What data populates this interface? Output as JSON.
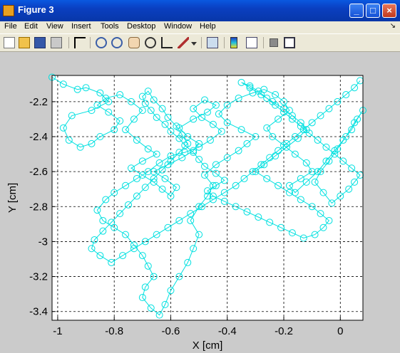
{
  "window": {
    "title": "Figure 3"
  },
  "menu": {
    "items": [
      "File",
      "Edit",
      "View",
      "Insert",
      "Tools",
      "Desktop",
      "Window",
      "Help"
    ],
    "overflow_glyph": "↘"
  },
  "toolbar": {
    "icons": [
      "new-figure-icon",
      "open-file-icon",
      "save-icon",
      "print-icon",
      "arrow-select-icon",
      "zoom-in-icon",
      "zoom-out-icon",
      "pan-hand-icon",
      "rotate-3d-icon",
      "data-cursor-icon",
      "brush-icon",
      "link-plot-icon",
      "colorbar-icon",
      "legend-icon",
      "hide-plot-tools-icon",
      "show-plot-tools-icon"
    ]
  },
  "colors": {
    "trace": "#00e0e0",
    "figure_bg": "#cbcbcb",
    "titlebar": "#0a4ad0"
  },
  "chart_data": {
    "type": "line",
    "xlabel": "X [cm]",
    "ylabel": "Y [cm]",
    "xlim": [
      -1.02,
      0.08
    ],
    "ylim": [
      -3.45,
      -2.05
    ],
    "xticks": [
      -1,
      -0.8,
      -0.6,
      -0.4,
      -0.2,
      0
    ],
    "yticks": [
      -2.2,
      -2.4,
      -2.6,
      -2.8,
      -3,
      -3.2,
      -3.4
    ],
    "grid": true,
    "marker": "circle",
    "series": [
      {
        "values_x": [
          -1.02,
          -0.98,
          -0.93,
          -0.9,
          -0.85,
          -0.82,
          -0.88,
          -0.95,
          -0.98,
          -0.96,
          -0.92,
          -0.88,
          -0.85,
          -0.8,
          -0.78,
          -0.82,
          -0.86,
          -0.83,
          -0.78,
          -0.74,
          -0.7,
          -0.73,
          -0.76,
          -0.72,
          -0.68,
          -0.65,
          -0.7,
          -0.74,
          -0.7,
          -0.66,
          -0.63,
          -0.6,
          -0.58,
          -0.62,
          -0.66,
          -0.61,
          -0.56,
          -0.52,
          -0.5,
          -0.54,
          -0.57,
          -0.52,
          -0.47,
          -0.44,
          -0.48,
          -0.52,
          -0.49,
          -0.45,
          -0.42,
          -0.46,
          -0.5,
          -0.55,
          -0.6,
          -0.64,
          -0.68,
          -0.72,
          -0.76,
          -0.8,
          -0.83,
          -0.86,
          -0.84,
          -0.8,
          -0.76,
          -0.73,
          -0.7,
          -0.68,
          -0.66,
          -0.69,
          -0.7,
          -0.67,
          -0.64,
          -0.62,
          -0.6,
          -0.57,
          -0.54,
          -0.52,
          -0.5,
          -0.53,
          -0.5,
          -0.47,
          -0.45,
          -0.48,
          -0.44,
          -0.4,
          -0.36,
          -0.33,
          -0.3,
          -0.35,
          -0.4,
          -0.43,
          -0.4,
          -0.36,
          -0.31,
          -0.27,
          -0.23,
          -0.2,
          -0.18,
          -0.22,
          -0.26,
          -0.24,
          -0.2,
          -0.16,
          -0.12,
          -0.1,
          -0.14,
          -0.18,
          -0.16,
          -0.12,
          -0.08,
          -0.05,
          -0.02,
          0.01,
          0.04,
          0.06,
          0.08,
          0.05,
          0.02,
          -0.01,
          -0.04,
          -0.07,
          -0.09,
          -0.06,
          -0.03,
          0.0,
          0.03,
          0.05,
          0.07,
          0.04,
          0.01,
          -0.02,
          -0.05,
          -0.08,
          -0.11,
          -0.14,
          -0.17,
          -0.2,
          -0.23,
          -0.26,
          -0.29,
          -0.32,
          -0.35,
          -0.32,
          -0.28,
          -0.24,
          -0.2,
          -0.17,
          -0.14,
          -0.12,
          -0.15,
          -0.19,
          -0.23,
          -0.27,
          -0.3,
          -0.26,
          -0.22,
          -0.18,
          -0.14,
          -0.1,
          -0.07,
          -0.04,
          -0.06,
          -0.09,
          -0.13,
          -0.17,
          -0.21,
          -0.25,
          -0.29,
          -0.33,
          -0.37,
          -0.41,
          -0.45,
          -0.47,
          -0.44,
          -0.41,
          -0.44,
          -0.48,
          -0.5,
          -0.52,
          -0.55,
          -0.57,
          -0.6,
          -0.62,
          -0.65,
          -0.67,
          -0.69,
          -0.7,
          -0.68,
          -0.66,
          -0.63,
          -0.61,
          -0.58,
          -0.56,
          -0.54,
          -0.57,
          -0.6,
          -0.63,
          -0.66,
          -0.69,
          -0.72,
          -0.75,
          -0.78,
          -0.81,
          -0.84,
          -0.87,
          -0.88,
          -0.85,
          -0.81,
          -0.77,
          -0.73,
          -0.69,
          -0.65,
          -0.61,
          -0.57,
          -0.53,
          -0.49,
          -0.45,
          -0.41,
          -0.37,
          -0.34,
          -0.31,
          -0.28,
          -0.25,
          -0.22,
          -0.19,
          -0.16,
          -0.13,
          -0.1,
          -0.07,
          -0.04,
          -0.01,
          0.02,
          0.05,
          0.07
        ],
        "values_y": [
          -2.06,
          -2.1,
          -2.13,
          -2.12,
          -2.15,
          -2.2,
          -2.25,
          -2.28,
          -2.35,
          -2.42,
          -2.46,
          -2.44,
          -2.4,
          -2.36,
          -2.31,
          -2.26,
          -2.22,
          -2.18,
          -2.16,
          -2.2,
          -2.25,
          -2.3,
          -2.36,
          -2.42,
          -2.47,
          -2.5,
          -2.54,
          -2.58,
          -2.62,
          -2.66,
          -2.7,
          -2.74,
          -2.69,
          -2.64,
          -2.6,
          -2.56,
          -2.52,
          -2.48,
          -2.44,
          -2.4,
          -2.35,
          -2.3,
          -2.26,
          -2.22,
          -2.19,
          -2.24,
          -2.29,
          -2.33,
          -2.37,
          -2.42,
          -2.46,
          -2.49,
          -2.51,
          -2.55,
          -2.6,
          -2.64,
          -2.68,
          -2.72,
          -2.76,
          -2.82,
          -2.88,
          -2.92,
          -2.96,
          -3.02,
          -3.08,
          -3.14,
          -3.2,
          -3.26,
          -3.32,
          -3.38,
          -3.42,
          -3.36,
          -3.28,
          -3.2,
          -3.12,
          -3.04,
          -2.96,
          -2.88,
          -2.8,
          -2.74,
          -2.68,
          -2.62,
          -2.56,
          -2.52,
          -2.48,
          -2.44,
          -2.4,
          -2.36,
          -2.32,
          -2.27,
          -2.22,
          -2.18,
          -2.15,
          -2.13,
          -2.16,
          -2.2,
          -2.25,
          -2.3,
          -2.35,
          -2.4,
          -2.45,
          -2.5,
          -2.55,
          -2.6,
          -2.64,
          -2.68,
          -2.72,
          -2.66,
          -2.6,
          -2.54,
          -2.48,
          -2.42,
          -2.36,
          -2.3,
          -2.25,
          -2.32,
          -2.4,
          -2.47,
          -2.54,
          -2.6,
          -2.66,
          -2.72,
          -2.78,
          -2.74,
          -2.7,
          -2.66,
          -2.62,
          -2.58,
          -2.54,
          -2.5,
          -2.46,
          -2.42,
          -2.38,
          -2.34,
          -2.3,
          -2.26,
          -2.22,
          -2.18,
          -2.14,
          -2.11,
          -2.09,
          -2.12,
          -2.16,
          -2.2,
          -2.24,
          -2.28,
          -2.32,
          -2.36,
          -2.41,
          -2.46,
          -2.51,
          -2.56,
          -2.6,
          -2.64,
          -2.68,
          -2.72,
          -2.76,
          -2.8,
          -2.84,
          -2.88,
          -2.92,
          -2.96,
          -2.98,
          -2.95,
          -2.92,
          -2.89,
          -2.86,
          -2.83,
          -2.8,
          -2.77,
          -2.74,
          -2.71,
          -2.68,
          -2.65,
          -2.61,
          -2.57,
          -2.53,
          -2.49,
          -2.45,
          -2.41,
          -2.37,
          -2.33,
          -2.29,
          -2.25,
          -2.21,
          -2.17,
          -2.14,
          -2.19,
          -2.24,
          -2.29,
          -2.34,
          -2.39,
          -2.44,
          -2.49,
          -2.54,
          -2.59,
          -2.64,
          -2.69,
          -2.74,
          -2.79,
          -2.84,
          -2.89,
          -2.94,
          -2.99,
          -3.04,
          -3.08,
          -3.12,
          -3.08,
          -3.04,
          -3.0,
          -2.96,
          -2.92,
          -2.88,
          -2.84,
          -2.8,
          -2.76,
          -2.72,
          -2.68,
          -2.64,
          -2.6,
          -2.56,
          -2.52,
          -2.48,
          -2.44,
          -2.4,
          -2.36,
          -2.32,
          -2.28,
          -2.24,
          -2.2,
          -2.16,
          -2.12,
          -2.08,
          -2.07,
          -2.12
        ]
      }
    ]
  }
}
